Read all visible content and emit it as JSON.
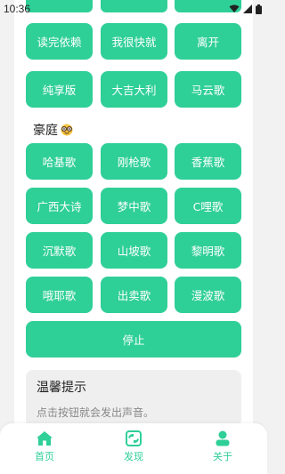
{
  "status_bar": {
    "time": "10:36"
  },
  "colors": {
    "accent": "#2fcf98",
    "background": "#f2f2f2",
    "tip_bg": "#efefef"
  },
  "top_row_buttons": [
    "",
    "",
    ""
  ],
  "buttons_group1": [
    "读完依赖",
    "我很快就",
    "离开",
    "纯享版",
    "大吉大利",
    "马云歌"
  ],
  "section": {
    "title": "豪庭",
    "emoji": "nerd-face-icon"
  },
  "buttons_group2": [
    "哈基歌",
    "刚枪歌",
    "香蕉歌",
    "广西大诗",
    "梦中歌",
    "C哩歌",
    "沉默歌",
    "山坡歌",
    "黎明歌",
    "哦耶歌",
    "出卖歌",
    "漫波歌"
  ],
  "stop_button": "停止",
  "tip": {
    "title": "温馨提示",
    "text": "点击按钮就会发出声音。"
  },
  "bottom_nav": [
    {
      "label": "首页",
      "icon": "home-icon"
    },
    {
      "label": "发现",
      "icon": "discover-icon"
    },
    {
      "label": "关于",
      "icon": "user-icon"
    }
  ]
}
